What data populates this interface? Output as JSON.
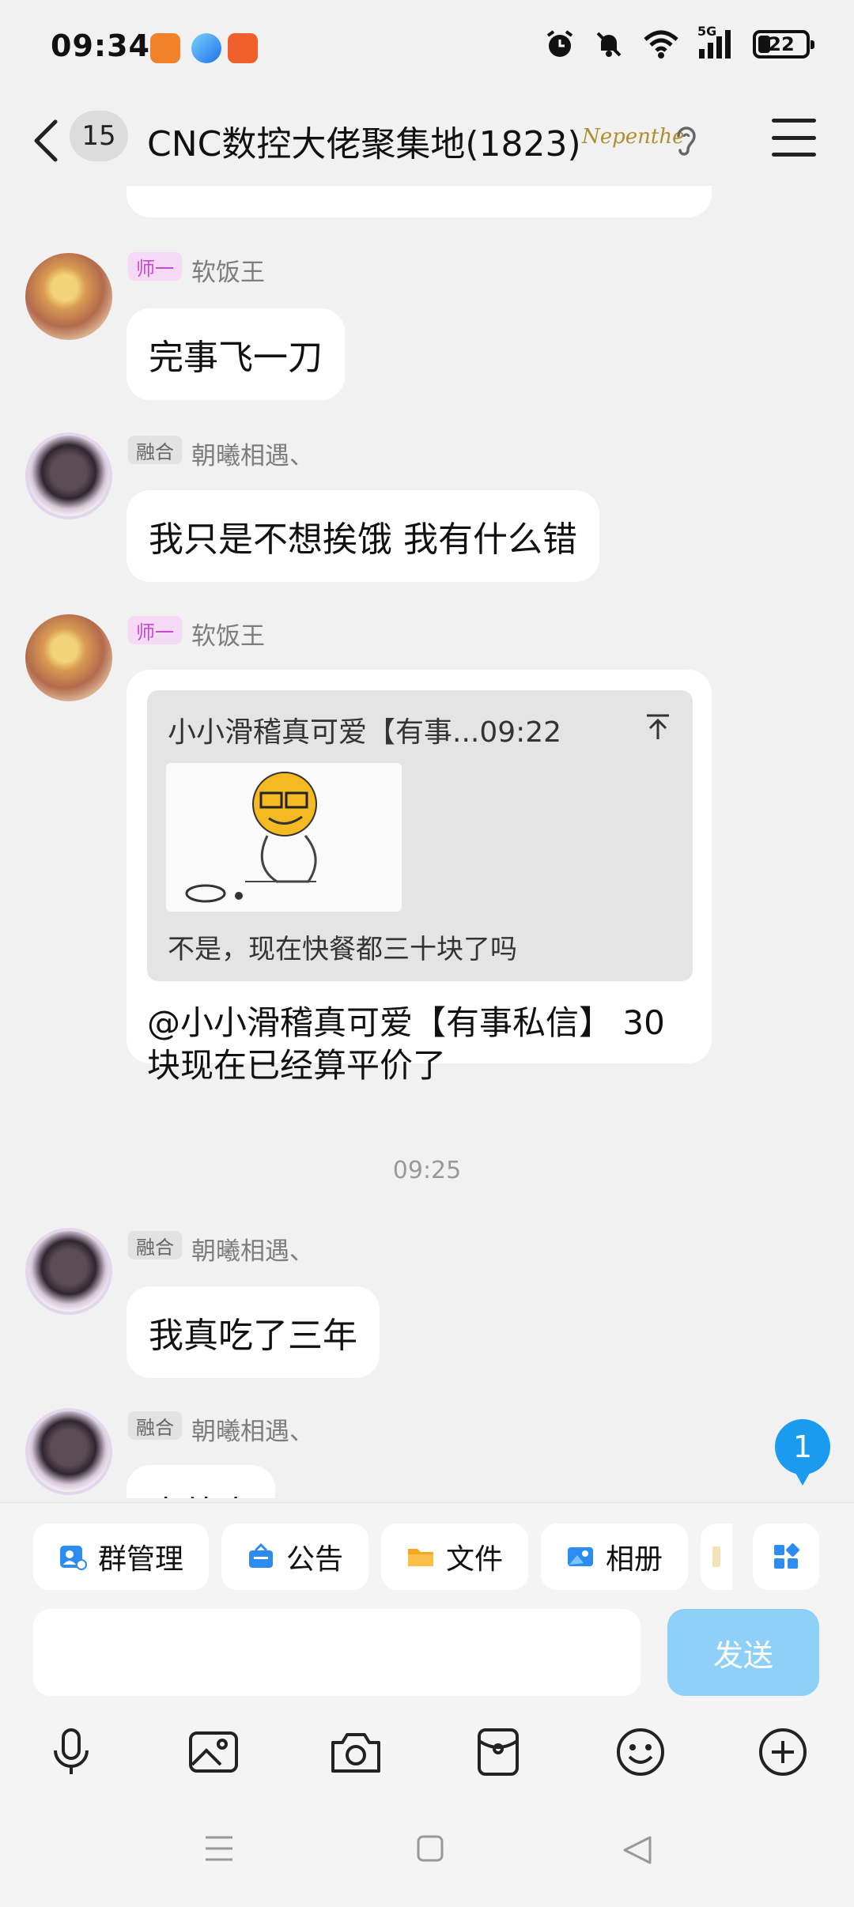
{
  "status_bar": {
    "time": "09:34",
    "network": "5G",
    "battery": "22"
  },
  "header": {
    "unread_count": "15",
    "title": "CNC数控大佬聚集地(1823)",
    "decoration": "Nepenthe"
  },
  "messages": [
    {
      "role": "师一",
      "nick": "软饭王",
      "text": "完事飞一刀"
    },
    {
      "role": "融合",
      "nick": "朝曦相遇、",
      "text": "我只是不想挨饿 我有什么错"
    },
    {
      "role": "师一",
      "nick": "软饭王",
      "quote": {
        "head": "小小滑稽真可爱【有事...09:22",
        "text": "不是，现在快餐都三十块了吗"
      },
      "text_line1": "@小小滑稽真可爱【有事私信】 30",
      "text_line2": "块现在已经算平价了"
    },
    {
      "role": "融合",
      "nick": "朝曦相遇、",
      "text": "我真吃了三年"
    },
    {
      "role": "融合",
      "nick": "朝曦相遇、",
      "text": "点外卖"
    }
  ],
  "timestamp": "09:25",
  "new_message_badge": "1",
  "toolbar": {
    "group_manage": "群管理",
    "notice": "公告",
    "files": "文件",
    "album": "相册"
  },
  "input": {
    "send_label": "发送"
  },
  "colors": {
    "accent": "#1a9bf0",
    "send_disabled": "#8fd0f8",
    "role_a": "#c24bd0"
  }
}
